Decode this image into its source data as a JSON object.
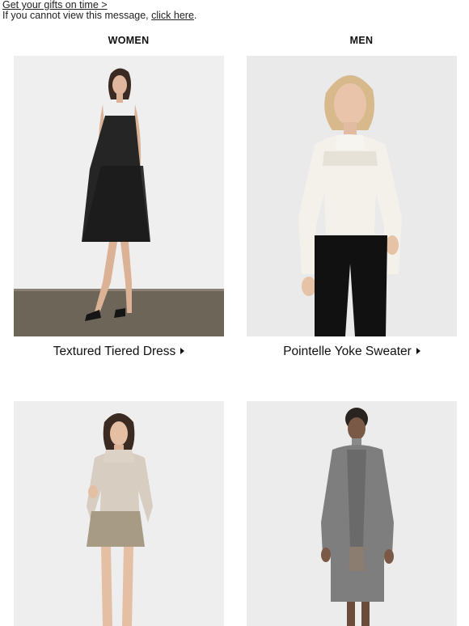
{
  "preheader": {
    "gifts_link": "Get your gifts on time >",
    "view_text": "If you cannot view this message, ",
    "click_here": "click here",
    "period": "."
  },
  "nav": {
    "women": "WOMEN",
    "men": "MEN"
  },
  "products": [
    {
      "name": "Textured Tiered Dress",
      "image_icon": "model-black-dress-photo"
    },
    {
      "name": "Pointelle Yoke Sweater",
      "image_icon": "model-white-sweater-photo"
    },
    {
      "name": "",
      "image_icon": "model-beige-sweater-skirt-photo"
    },
    {
      "name": "",
      "image_icon": "model-grey-coat-photo"
    }
  ],
  "colors": {
    "background": "#ffffff",
    "studio": "#efefef",
    "floor": "#6e6559",
    "text": "#111111"
  }
}
